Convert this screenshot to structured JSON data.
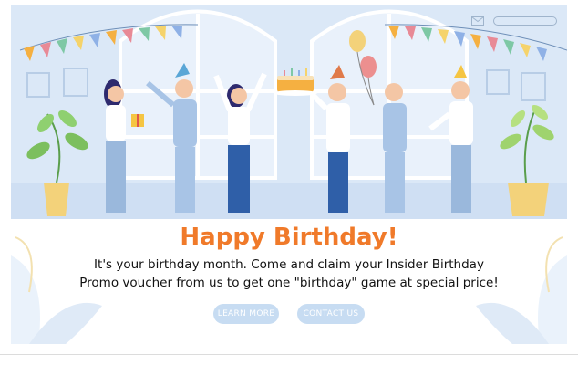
{
  "banner": {
    "title": "Happy Birthday!",
    "message_line1": "It's your birthday month. Come and claim your Insider Birthday",
    "message_line2": "Promo voucher from us to get one \"birthday\" game at special price!"
  },
  "buttons": {
    "learn_more": "LEARN MORE",
    "contact_us": "CONTACT US"
  },
  "colors": {
    "title": "#f07a2a",
    "button_bg": "#c7dcf2",
    "scene_bg": "#dbe8f7"
  },
  "icons": [
    "mail-icon",
    "search-icon",
    "cake-icon",
    "balloon-icon",
    "bunting-icon"
  ]
}
